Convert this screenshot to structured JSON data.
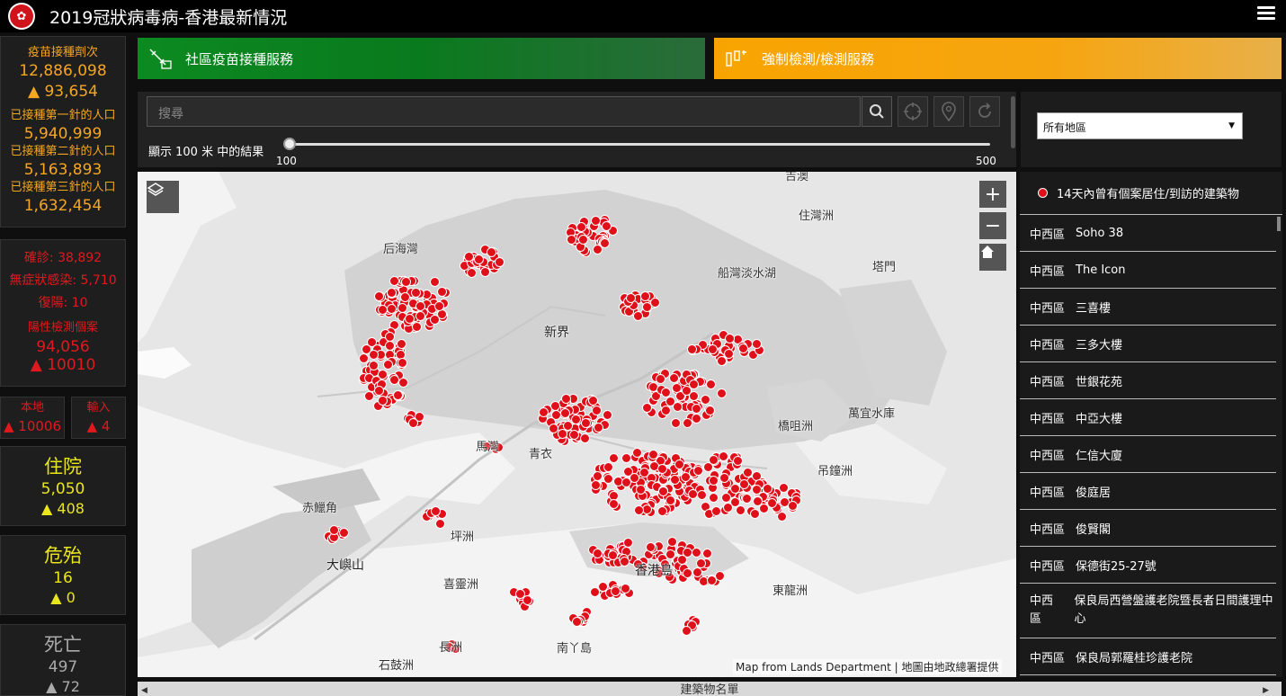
{
  "header": {
    "title": "2019冠狀病毒病-香港最新情況",
    "emblem_glyph": "✿"
  },
  "vaccination": {
    "doses_label": "疫苗接種劑次",
    "doses_value": "12,886,098",
    "doses_change": "▲ 93,654",
    "first_label": "已接種第一針的人口",
    "first_value": "5,940,999",
    "second_label": "已接種第二針的人口",
    "second_value": "5,163,893",
    "third_label": "已接種第三針的人口",
    "third_value": "1,632,454"
  },
  "cases": {
    "confirmed": "確診: 38,892",
    "asymptomatic": "無症狀感染: 5,710",
    "repositive": "復陽: 10",
    "positive_label": "陽性檢測個案",
    "positive_value": "94,056",
    "positive_change": "▲ 10010"
  },
  "local": {
    "label": "本地",
    "value": "▲ 10006"
  },
  "imported": {
    "label": "輸入",
    "value": "▲ 4"
  },
  "hospitalised": {
    "label": "住院",
    "value": "5,050",
    "change": "▲ 408"
  },
  "critical": {
    "label": "危殆",
    "value": "16",
    "change": "▲ 0"
  },
  "deaths": {
    "label": "死亡",
    "value": "497",
    "change": "▲ 72"
  },
  "services": {
    "vaccine_label": "社區疫苗接種服務",
    "testing_label": "強制檢測/檢測服務"
  },
  "search": {
    "placeholder": "搜尋",
    "distance_label": "顯示 100 米 中的結果",
    "slider_min": "100",
    "slider_max": "500",
    "slider_value": 100
  },
  "region": {
    "selected": "所有地區"
  },
  "map": {
    "labels": [
      "后海灣",
      "住灣洲",
      "船灣淡水湖",
      "塔門",
      "新界",
      "橋咀洲",
      "萬宜水庫",
      "馬灣",
      "青衣",
      "吊鐘洲",
      "赤鱲角",
      "大嶼山",
      "坪洲",
      "喜靈洲",
      "香港島",
      "東龍洲",
      "南丫島",
      "石鼓洲",
      "長洲",
      "吉澳"
    ],
    "attribution": "Map from Lands Department | 地圖由地政總署提供"
  },
  "legend": {
    "label": "14天內曾有個案居住/到訪的建築物"
  },
  "buildings": [
    {
      "district": "中西區",
      "name": "Soho 38"
    },
    {
      "district": "中西區",
      "name": "The Icon"
    },
    {
      "district": "中西區",
      "name": "三喜樓"
    },
    {
      "district": "中西區",
      "name": "三多大樓"
    },
    {
      "district": "中西區",
      "name": "世銀花苑"
    },
    {
      "district": "中西區",
      "name": "中亞大樓"
    },
    {
      "district": "中西區",
      "name": "仁信大廈"
    },
    {
      "district": "中西區",
      "name": "俊庭居"
    },
    {
      "district": "中西區",
      "name": "俊賢閣"
    },
    {
      "district": "中西區",
      "name": "保德街25-27號"
    },
    {
      "district": "中西區",
      "name": "保良局西營盤護老院暨長者日間護理中心"
    },
    {
      "district": "中西區",
      "name": "保良局郭羅桂珍護老院"
    }
  ],
  "bottom": {
    "label": "建築物名單"
  },
  "colors": {
    "accent_red": "#e0191f",
    "vaccine_orange": "#f5a623",
    "hosp_yellow": "#e9e61c",
    "service_green": "#0c8a20",
    "service_orange": "#f8a400"
  }
}
